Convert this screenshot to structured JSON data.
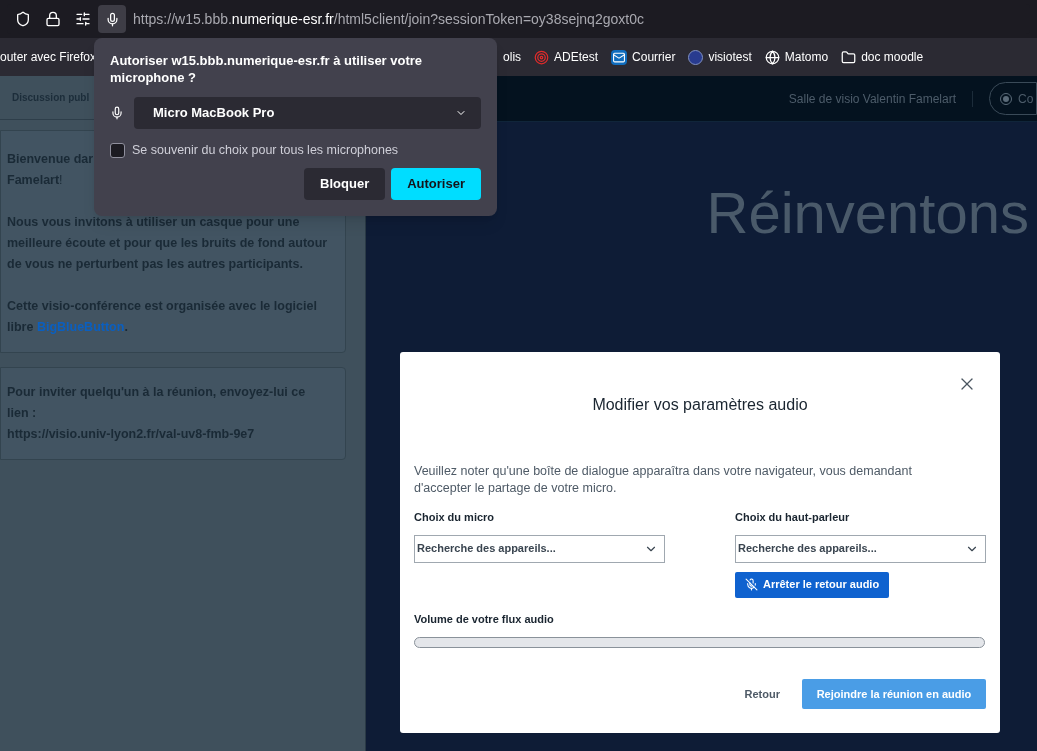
{
  "browser": {
    "url": {
      "prefix": "https://w15.bbb.",
      "host": "numerique-esr.fr",
      "path": "/html5client/join?sessionToken=oy38sejnq2goxt0c"
    },
    "bookmarks_left": [
      {
        "label": "outer avec Firefox"
      }
    ],
    "bookmarks_right": [
      {
        "label": "olis"
      },
      {
        "label": "ADEtest",
        "kind": "target"
      },
      {
        "label": "Courrier",
        "kind": "mail"
      },
      {
        "label": "visiotest",
        "kind": "badge"
      },
      {
        "label": "Matomo",
        "kind": "globe"
      },
      {
        "label": "doc moodle",
        "kind": "folder"
      }
    ]
  },
  "permission_popup": {
    "title": "Autoriser w15.bbb.numerique-esr.fr à utiliser votre microphone ?",
    "device": "Micro MacBook Pro",
    "remember": {
      "label": "Se souvenir du choix pour tous les microphones",
      "checked": false
    },
    "buttons": [
      {
        "label": "Bloquer",
        "kind": "secondary"
      },
      {
        "label": "Autoriser",
        "kind": "primary"
      }
    ]
  },
  "sidebar": {
    "header": "Discussion publ",
    "welcome_line_1": "Bienvenue dar",
    "welcome_line_2": "**Famelart**!",
    "paragraph": "Nous vous invitons à utiliser un casque pour une meilleure écoute et pour que les bruits de fond autour de vous ne perturbent pas les autres participants.",
    "software_text": "Cette visio-conférence est organisée avec le logiciel libre",
    "software_link": "BigBlueButton",
    "software_end": ".",
    "invite_text": "Pour inviter quelqu'un à la réunion, envoyez-lui ce lien :",
    "invite_url": "https://visio.univ-lyon2.fr/val-uv8-fmb-9e7"
  },
  "header": {
    "room_title": "Salle de visio Valentin Famelart",
    "recording_label": "Co"
  },
  "presentation": {
    "headline": "Réinventons"
  },
  "modal": {
    "title": "Modifier vos paramètres audio",
    "note": "Veuillez noter qu'une boîte de dialogue apparaîtra dans votre navigateur, vous demandant d'accepter le partage de votre micro.",
    "mic": {
      "label": "Choix du micro",
      "value": "Recherche des appareils..."
    },
    "speaker": {
      "label": "Choix du haut-parleur",
      "value": "Recherche des appareils..."
    },
    "feedback_button": "Arrêter le retour audio",
    "volume": {
      "label": "Volume de votre flux audio",
      "level": 0
    },
    "back_button": "Retour",
    "join_button": "Rejoindre la réunion en audio"
  }
}
